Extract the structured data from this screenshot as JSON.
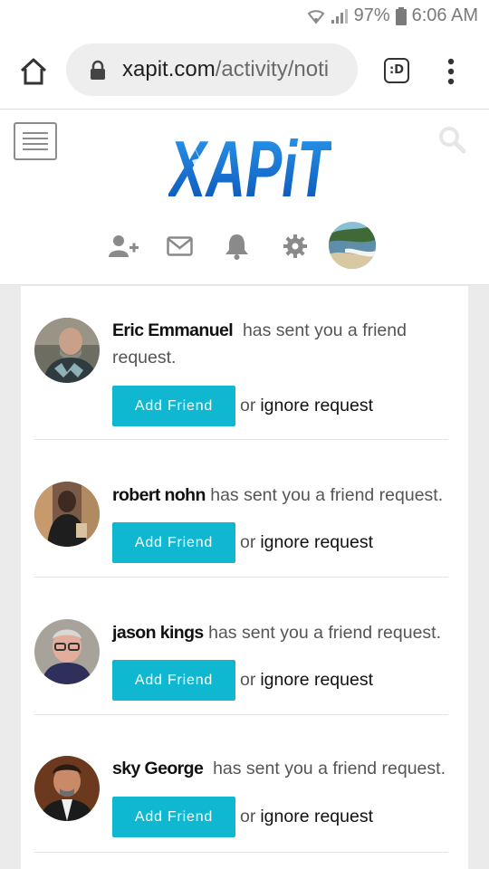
{
  "status_bar": {
    "battery_percent": "97%",
    "time": "6:06 AM",
    "icons": [
      "wifi-icon",
      "signal-icon",
      "battery-icon"
    ]
  },
  "browser": {
    "url_domain": "xapit.com",
    "url_path": "/activity/noti",
    "tabs_label": ":D",
    "icons": [
      "home-icon",
      "lock-icon",
      "more-vert-icon"
    ]
  },
  "site": {
    "logo_text": "XAPiT",
    "header_icons": [
      "menu-icon",
      "search-icon",
      "add-friend-icon",
      "mail-icon",
      "bell-icon",
      "gear-icon",
      "profile-avatar"
    ]
  },
  "notifications": [
    {
      "name": "Eric Emmanuel",
      "message": "has sent you a friend request.",
      "button_label": "Add Friend",
      "or_text": "or",
      "ignore_label": "ignore request"
    },
    {
      "name": "robert nohn",
      "message": "has sent you a friend request.",
      "button_label": "Add Friend",
      "or_text": "or",
      "ignore_label": "ignore request"
    },
    {
      "name": "jason kings",
      "message": "has sent you a friend request.",
      "button_label": "Add Friend",
      "or_text": "or",
      "ignore_label": "ignore request"
    },
    {
      "name": "sky George",
      "message": "has sent you a friend request.",
      "button_label": "Add Friend",
      "or_text": "or",
      "ignore_label": "ignore request"
    }
  ],
  "colors": {
    "accent_button": "#0fb7d0",
    "logo_blue": "#1a7fd6",
    "icon_gray": "#8a8a8a"
  }
}
